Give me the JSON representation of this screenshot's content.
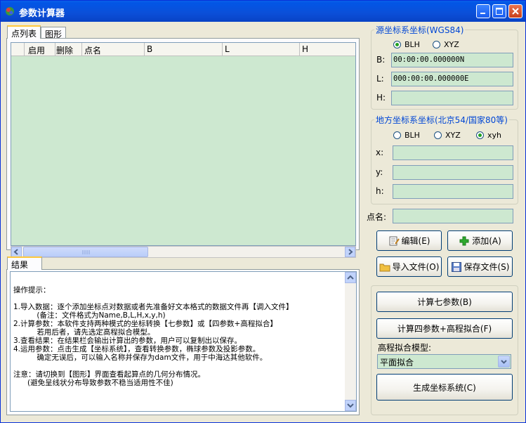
{
  "window": {
    "title": "参数计算器",
    "controls": {
      "minimize": "minimize",
      "maximize": "maximize",
      "close": "close"
    }
  },
  "top_tabs": [
    {
      "label": "点列表"
    },
    {
      "label": "图形"
    }
  ],
  "point_table": {
    "columns": [
      "启用",
      "删除",
      "点名",
      "B",
      "L",
      "H"
    ],
    "rows": []
  },
  "result_tab": {
    "label": "结果"
  },
  "result_text": {
    "lines": [
      "操作提示：",
      "",
      "1.导入数据：逐个添加坐标点对数据或者先准备好文本格式的数据文件再【调入文件】",
      "          (备注：文件格式为Name,B,L,H,x,y,h)",
      "2.计算参数：本软件支持两种模式的坐标转换【七参数】或【四参数+高程拟合】",
      "          若用后者，请先选定高程拟合模型。",
      "3.查看结果：在结果栏会输出计算出的参数，用户可以复制出以保存。",
      "4.运用参数：点击生成【坐标系统】，查看转换参数，椭球参数及投影参数。",
      "          确定无误后，可以输入名称并保存为dam文件，用于中海达其他软件。",
      "",
      "注意：请切换到【图形】界面查看起算点的几何分布情况。",
      "      (避免呈线状分布导致参数不稳当适用性不佳)"
    ]
  },
  "source_group": {
    "title": "源坐标系坐标(WGS84)",
    "modes": [
      {
        "label": "BLH",
        "selected": true
      },
      {
        "label": "XYZ",
        "selected": false
      }
    ],
    "fields": [
      {
        "label": "B:",
        "value": "00:00:00.000000N"
      },
      {
        "label": "L:",
        "value": "000:00:00.000000E"
      },
      {
        "label": "H:",
        "value": ""
      }
    ]
  },
  "local_group": {
    "title": "地方坐标系坐标(北京54/国家80等)",
    "modes": [
      {
        "label": "BLH",
        "selected": false
      },
      {
        "label": "XYZ",
        "selected": false
      },
      {
        "label": "xyh",
        "selected": true
      }
    ],
    "fields": [
      {
        "label": "x:",
        "value": ""
      },
      {
        "label": "y:",
        "value": ""
      },
      {
        "label": "h:",
        "value": ""
      }
    ]
  },
  "point_name": {
    "label": "点名:",
    "value": ""
  },
  "buttons": {
    "edit": "编辑(E)",
    "add": "添加(A)",
    "import": "导入文件(O)",
    "save": "保存文件(S)"
  },
  "calc": {
    "seven_params": "计算七参数(B)",
    "four_params": "计算四参数+高程拟合(F)",
    "model_label": "高程拟合模型:",
    "model_value": "平面拟合",
    "generate": "生成坐标系统(C)"
  },
  "colors": {
    "title_bar": "#0a5fe8",
    "window_bg": "#ece9d8",
    "field_bg": "#cde8d0",
    "group_title": "#0046d5"
  }
}
